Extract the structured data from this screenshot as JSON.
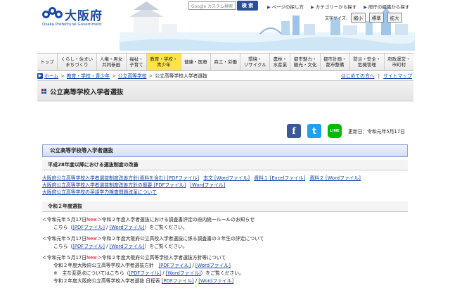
{
  "header": {
    "logo_name": "大阪府",
    "logo_en": "Osaka Prefectural Government",
    "search_placeholder": "Google カスタム検索",
    "search_button": "検 索",
    "top_links": [
      "ページの探し方",
      "カテゴリーから探す",
      "府庁の組織から探す"
    ],
    "font_size_label": "文字サイズ:",
    "font_sizes": [
      "縮小",
      "標準",
      "拡大"
    ]
  },
  "nav": {
    "items": [
      "トップ",
      "くらし・住まい\nまちづくり",
      "人権・男女\n共同参画",
      "福祉・\n子育て",
      "教育・学校・\n青少年",
      "健康・医療",
      "商工・労働",
      "環境・\nリサイクル",
      "農林・\n水産業",
      "都市魅力・\n観光・文化",
      "都市計画・\n都市整備",
      "防災・安全・\n危機管理",
      "府政運営・\n市町村"
    ],
    "active_index": 4
  },
  "breadcrumb": {
    "items": [
      "ホーム",
      "教育・学校・青少年",
      "公立高等学校",
      "公立高等学校入学者選抜"
    ],
    "right_links": [
      "はじめての方へ",
      "サイトマップ"
    ]
  },
  "page": {
    "title": "公立高等学校入学者選抜",
    "updated": "更新日：令和元年5月17日"
  },
  "social": [
    "f",
    "t",
    "LINE"
  ],
  "content": {
    "section_title": "公立高等学校等入学者選抜",
    "sub1_title": "平成28年度以降における選抜制度の改善",
    "sub1_links": [
      [
        "大阪府公立高等学校入学者選抜制度改善方針(資料を含む) [PDFファイル]",
        "本文 [Wordファイル]",
        "資料１ [Excelファイル]",
        "資料２ [Wordファイル]"
      ],
      [
        "大阪府公立高等学校入学者選抜制度改善方針の概要 [PDFファイル]",
        "[Wordファイル]"
      ],
      [
        "大阪府公立高等学校の英語学力検査問題改革について"
      ]
    ],
    "sub2_title": "令和２年度選抜",
    "notices": [
      {
        "head_pre": "＜令和元年５月17日",
        "new": "New",
        "head_post": "＞令和２年度入学者選抜における調査書評定の府内統一ルールのお知らせ",
        "line": [
          "こちら（",
          "[PDFファイル]",
          "/",
          "[Wordファイル]",
          "）をご覧ください。"
        ]
      },
      {
        "head_pre": "＜令和元年５月17日",
        "new": "New",
        "head_post": "＞令和２年度大阪府公立高校入学者選抜に係る調査書の３年生の評定について",
        "line": [
          "こちら（",
          "[PDFファイル]",
          "/",
          "[Wordファイル]",
          "）をご覧ください。"
        ]
      },
      {
        "head_pre": "＜令和元年５月17日",
        "new": "New",
        "head_post": "＞令和２年度大阪府公立高等学校入学者選抜方針等について",
        "sublines": [
          [
            "令和２年度大阪府公立高等学校入学者選抜方針",
            "[PDFファイル]",
            "/",
            "[Wordファイル]"
          ],
          [
            "※　主な変更点についてはこちら（",
            "[PDFファイル]",
            "/",
            "[Wordファイル]",
            "）をご覧ください。"
          ],
          [
            "令和２年度大阪府公立高等学校入学者選抜 日程表",
            "[PDFファイル]",
            "/",
            "[Wordファイル]"
          ]
        ]
      }
    ]
  },
  "colors": {
    "brand": "#1a4aa8",
    "link": "#1a3fa8",
    "new": "#d9001b",
    "active_nav": "#ffe34a"
  }
}
